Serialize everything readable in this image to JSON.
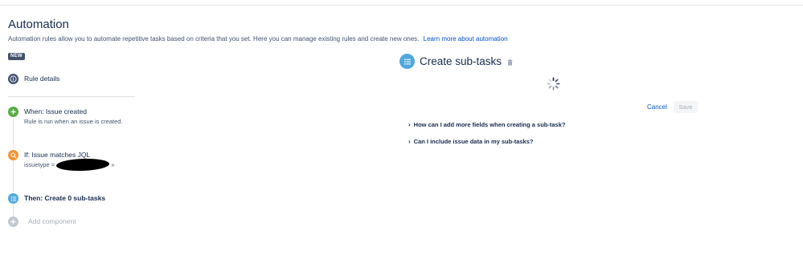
{
  "header": {
    "title": "Automation",
    "description": "Automation rules allow you to automate repetitive tasks based on criteria that you set. Here you can manage existing rules and create new ones.",
    "learn_more": "Learn more about automation",
    "badge": "NEW"
  },
  "steps": {
    "rule_details": {
      "label": "Rule details",
      "icon": "info-icon",
      "color": "#42526e"
    },
    "when": {
      "label": "When: Issue created",
      "sub": "Rule is run when an issue is created.",
      "icon": "plus-icon",
      "color": "#5aac44"
    },
    "if": {
      "label": "If: Issue matches JQL",
      "sub_prefix": "issuetype =",
      "sub_suffix": "»",
      "icon": "search-icon",
      "color": "#f79232"
    },
    "then": {
      "label": "Then: Create 0 sub-tasks",
      "icon": "list-icon",
      "color": "#4ea8dd"
    },
    "add": {
      "label": "Add component",
      "icon": "plus-icon",
      "color": "#c1c7d0"
    }
  },
  "panel": {
    "title": "Create sub-tasks",
    "cancel": "Cancel",
    "save": "Save",
    "faqs": [
      "How can I add more fields when creating a sub-task?",
      "Can I include issue data in my sub-tasks?"
    ]
  }
}
